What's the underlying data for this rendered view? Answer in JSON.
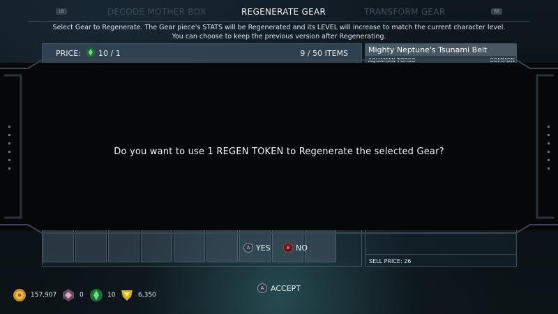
{
  "tabs": {
    "left_trigger": "LB",
    "right_trigger": "RB",
    "items": [
      "DECODE MOTHER BOX",
      "REGENERATE GEAR",
      "TRANSFORM GEAR"
    ],
    "active": "REGENERATE GEAR"
  },
  "instructions": [
    "Select Gear to Regenerate. The Gear piece's STATS will be Regenerated and its LEVEL will increase to match the current character level.",
    "You can choose to keep the previous version after Regenerating."
  ],
  "list_panel": {
    "price_label": "PRICE:",
    "price_value": "10 / 1",
    "items_count": "9 / 50 ITEMS"
  },
  "detail_panel": {
    "item_name": "Mighty Neptune's Tsunami Belt",
    "item_slot": "AQUAMAN TORSO",
    "item_rarity": "COMMON",
    "sell_price": "SELL PRICE: 26"
  },
  "dialog": {
    "question": "Do you want to use 1 REGEN TOKEN to Regenerate the selected Gear?",
    "yes_button": "A",
    "yes_label": "YES",
    "no_button": "B",
    "no_label": "NO"
  },
  "footer": {
    "accept_button": "A",
    "accept_label": "ACCEPT"
  },
  "currencies": [
    {
      "icon": "gold-coin-icon",
      "value": "157,907",
      "color": "#c8902a"
    },
    {
      "icon": "source-crystal-icon",
      "value": "0",
      "color": "#b888a8"
    },
    {
      "icon": "regen-token-icon",
      "value": "10",
      "color": "#3cab5c"
    },
    {
      "icon": "shield-token-icon",
      "value": "6,350",
      "color": "#d8b020"
    }
  ],
  "colors": {
    "selected_slot": "#c9a520",
    "gear_slot": "#3d5a78",
    "no_button": "#b04048"
  }
}
